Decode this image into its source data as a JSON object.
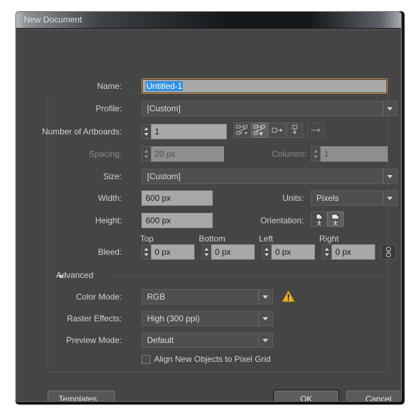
{
  "window": {
    "title": "New Document"
  },
  "fields": {
    "name_label": "Name:",
    "name_value": "Untitled-1",
    "profile_label": "Profile:",
    "profile_value": "[Custom]",
    "artboards_label": "Number of Artboards:",
    "artboards_value": "1",
    "spacing_label": "Spacing:",
    "spacing_value": "20 px",
    "columns_label": "Columns:",
    "columns_value": "1",
    "size_label": "Size:",
    "size_value": "[Custom]",
    "width_label": "Width:",
    "width_value": "600 px",
    "height_label": "Height:",
    "height_value": "600 px",
    "units_label": "Units:",
    "units_value": "Pixels",
    "orientation_label": "Orientation:"
  },
  "bleed": {
    "label": "Bleed:",
    "top_label": "Top",
    "bottom_label": "Bottom",
    "left_label": "Left",
    "right_label": "Right",
    "top_value": "0 px",
    "bottom_value": "0 px",
    "left_value": "0 px",
    "right_value": "0 px"
  },
  "advanced": {
    "header": "Advanced",
    "color_mode_label": "Color Mode:",
    "color_mode_value": "RGB",
    "raster_label": "Raster Effects:",
    "raster_value": "High (300 ppi)",
    "preview_label": "Preview Mode:",
    "preview_value": "Default",
    "align_pixel_grid_label": "Align New Objects to Pixel Grid",
    "align_pixel_grid_checked": false
  },
  "footer": {
    "templates_label": "Templates...",
    "ok_label": "OK",
    "cancel_label": "Cancel"
  },
  "icons": {
    "artboard_grid_row": "grid-by-row-icon",
    "artboard_grid_column": "grid-by-column-icon",
    "artboard_row": "arrange-row-icon",
    "artboard_column": "arrange-column-icon",
    "artboard_direction": "right-to-left-icon",
    "orientation_portrait": "portrait-icon",
    "orientation_landscape": "landscape-icon",
    "bleed_link": "link-bleed-icon",
    "color_mode_warning": "warning-icon"
  },
  "colors": {
    "dialog_bg": "#454545",
    "field_bg": "#a8a8a8",
    "focus_border": "#c98a3c",
    "selection_blue": "#2f8fe0",
    "warning_yellow": "#e8b524"
  }
}
